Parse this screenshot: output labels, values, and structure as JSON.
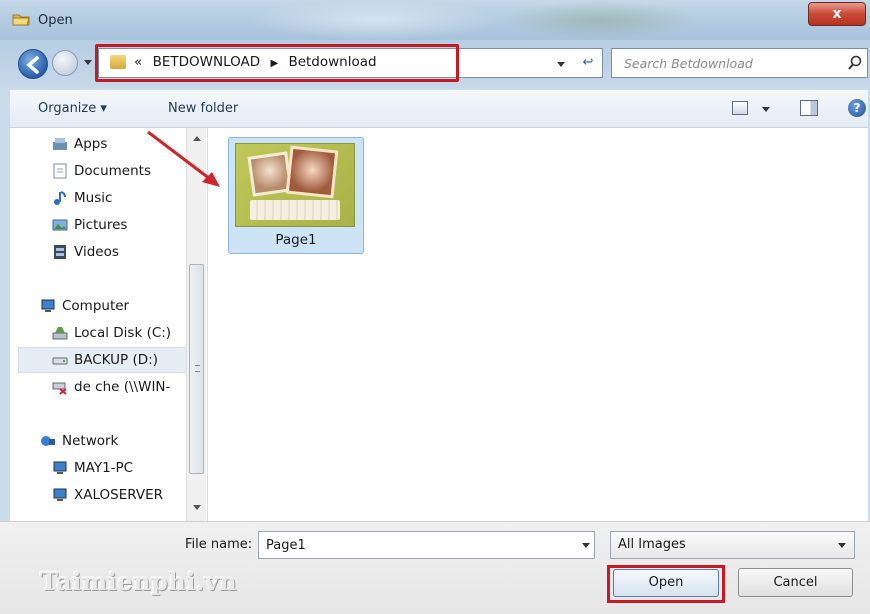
{
  "window": {
    "title": "Open",
    "close_label": "x"
  },
  "address": {
    "prefix": "«",
    "crumbs": [
      "BETDOWNLOAD",
      "Betdownload"
    ],
    "separator": "▶"
  },
  "search": {
    "placeholder": "Search Betdownload"
  },
  "toolbar": {
    "organize_label": "Organize ▾",
    "new_folder_label": "New folder"
  },
  "nav": {
    "items": [
      {
        "label": "Apps",
        "icon": "apps-icon"
      },
      {
        "label": "Documents",
        "icon": "documents-icon"
      },
      {
        "label": "Music",
        "icon": "music-icon"
      },
      {
        "label": "Pictures",
        "icon": "pictures-icon"
      },
      {
        "label": "Videos",
        "icon": "videos-icon"
      },
      {
        "label": "Computer",
        "icon": "computer-icon"
      },
      {
        "label": "Local Disk (C:)",
        "icon": "local-disk-icon"
      },
      {
        "label": "BACKUP (D:)",
        "icon": "drive-icon"
      },
      {
        "label": "de che (\\\\WIN-",
        "icon": "network-drive-icon"
      },
      {
        "label": "Network",
        "icon": "network-icon"
      },
      {
        "label": "MAY1-PC",
        "icon": "pc-icon"
      },
      {
        "label": "XALOSERVER",
        "icon": "pc-icon"
      }
    ],
    "selected": "BACKUP (D:)"
  },
  "files": [
    {
      "name": "Page1",
      "type": "image"
    }
  ],
  "bottom": {
    "file_name_label": "File name:",
    "file_name_value": "Page1",
    "file_type_value": "All Images",
    "open_label": "Open",
    "cancel_label": "Cancel"
  },
  "watermark": "Taimienphi.vn",
  "colors": {
    "highlight": "#c41b24",
    "selection": "#cde4f7"
  }
}
